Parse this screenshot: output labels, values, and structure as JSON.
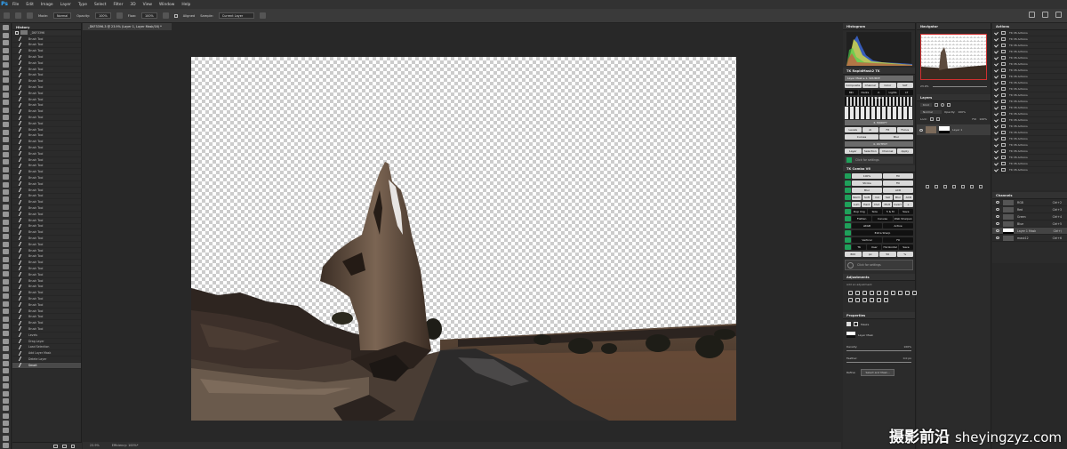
{
  "menu": [
    "File",
    "Edit",
    "Image",
    "Layer",
    "Type",
    "Select",
    "Filter",
    "3D",
    "View",
    "Window",
    "Help"
  ],
  "options": {
    "mode_label": "Mode:",
    "mode_value": "Normal",
    "opacity_label": "Opacity:",
    "opacity_value": "100%",
    "flow_label": "Flow:",
    "flow_value": "100%",
    "aligned_label": "Aligned",
    "sample_label": "Sample:",
    "sample_value": "Current Layer"
  },
  "history": {
    "title": "History",
    "snapshot": "_DKF3396",
    "items": [
      "Brush Tool",
      "Brush Tool",
      "Brush Tool",
      "Brush Tool",
      "Brush Tool",
      "Brush Tool",
      "Brush Tool",
      "Brush Tool",
      "Brush Tool",
      "Brush Tool",
      "Brush Tool",
      "Brush Tool",
      "Brush Tool",
      "Brush Tool",
      "Brush Tool",
      "Brush Tool",
      "Brush Tool",
      "Brush Tool",
      "Brush Tool",
      "Brush Tool",
      "Brush Tool",
      "Brush Tool",
      "Brush Tool",
      "Brush Tool",
      "Brush Tool",
      "Brush Tool",
      "Brush Tool",
      "Brush Tool",
      "Brush Tool",
      "Brush Tool",
      "Brush Tool",
      "Brush Tool",
      "Brush Tool",
      "Brush Tool",
      "Brush Tool",
      "Brush Tool",
      "Brush Tool",
      "Brush Tool",
      "Brush Tool",
      "Brush Tool",
      "Brush Tool",
      "Brush Tool",
      "Brush Tool",
      "Brush Tool",
      "Brush Tool",
      "Brush Tool",
      "Brush Tool",
      "Brush Tool",
      "Brush Tool",
      "Levels",
      "Drag Layer",
      "Load Selection",
      "Add Layer Mask",
      "Delete Layer",
      "Smart"
    ],
    "selected_index": 54
  },
  "document": {
    "tab_title": "_DKF3396-3 @ 23.9% (Layer 1, Layer Mask/16) *",
    "status_zoom": "23.9%",
    "status_info": "Efficiency: 100%*"
  },
  "histogram": {
    "title": "Histogram"
  },
  "tk_rapid": {
    "title": "TK RapidMask2 TK",
    "row1": "Layer Mask ▸ 1. SOURCE",
    "buttons1": [
      "Composite",
      "Channel",
      "Color",
      "SAT"
    ],
    "row2": [
      "MD",
      "Darks",
      "2. MASKS",
      "Lights",
      "LT"
    ],
    "modify_label": "3. MODIFY",
    "buttons3": [
      "Levels",
      "Al",
      "Fit",
      "Focus"
    ],
    "buttons4": [
      "Curves",
      "Blur"
    ],
    "output_label": "4. OUTPUT",
    "buttons5": [
      "Layer",
      "Selection",
      "Channel",
      "Apply"
    ],
    "click_settings": "Click for settings"
  },
  "tk_combo": {
    "title": "TK Combo V6",
    "rows": [
      [
        "100%",
        "Fill"
      ],
      [
        "Stroke",
        "Fill"
      ],
      [
        "Blur",
        "ACR"
      ],
      [
        "Norm",
        "Soft",
        "Col",
        "Sat",
        "Blur",
        "ACR"
      ],
      [
        "Lum",
        "Hard",
        "Dvd",
        "Mult",
        "Invert",
        "+ Select"
      ],
      [
        "Dup Img",
        "Size",
        "5 & M",
        "Save"
      ],
      [
        "Flatten",
        "Canvas",
        "Web Sharpen"
      ],
      [
        "sRGB",
        "Active"
      ],
      [
        "Extra Sharp"
      ],
      [
        "Vertical",
        "Fit"
      ],
      [
        "TK",
        "User",
        "Horizontal",
        "Save"
      ]
    ],
    "web_values": [
      "800",
      "px",
      "50",
      "%"
    ],
    "click_settings": "Click for settings"
  },
  "adjustments": {
    "title": "Adjustments",
    "subtitle": "Add an adjustment"
  },
  "properties": {
    "title": "Properties",
    "masks_label": "Masks",
    "layer_mask_label": "Layer Mask",
    "density_label": "Density:",
    "density_value": "100%",
    "feather_label": "Feather:",
    "feather_value": "0.0 px",
    "refine_label": "Refine:",
    "select_mask_button": "Select and Mask..."
  },
  "navigator": {
    "title": "Navigator",
    "zoom": "23.9%"
  },
  "layers": {
    "title": "Layers",
    "kind_label": "Kind",
    "blend_mode": "Normal",
    "opacity_label": "Opacity:",
    "opacity_value": "100%",
    "lock_label": "Lock:",
    "fill_label": "Fill:",
    "fill_value": "100%",
    "items": [
      {
        "name": "Layer 1"
      }
    ]
  },
  "channels": {
    "title": "Channels",
    "rows": [
      {
        "name": "RGB",
        "shortcut": "Ctrl+2"
      },
      {
        "name": "Red",
        "shortcut": "Ctrl+3"
      },
      {
        "name": "Green",
        "shortcut": "Ctrl+4"
      },
      {
        "name": "Blue",
        "shortcut": "Ctrl+5"
      },
      {
        "name": "Layer 1 Mask",
        "shortcut": "Ctrl+\\"
      },
      {
        "name": "mask12",
        "shortcut": "Ctrl+6"
      }
    ]
  },
  "actions": {
    "title": "Actions",
    "items": [
      "TK V6 Actions",
      "TK V6 Actions",
      "TK V6 Actions",
      "TK V6 Actions",
      "TK V6 Actions",
      "TK V6 Actions",
      "TK V6 Actions",
      "TK V6 Actions",
      "TK V6 Actions",
      "TK V6 Actions",
      "TK V6 Actions",
      "TK V6 Actions",
      "TK V6 Actions",
      "TK V6 Actions",
      "TK V6 Actions",
      "TK V6 Actions",
      "TK V6 Actions",
      "TK V6 Actions",
      "TK V6 Actions",
      "TK V6 Actions",
      "TK V6 Actions",
      "TK V6 Actions",
      "TK V6 Actions"
    ]
  },
  "watermark": {
    "cn": "摄影前沿",
    "en": "sheyingzyz.com"
  }
}
